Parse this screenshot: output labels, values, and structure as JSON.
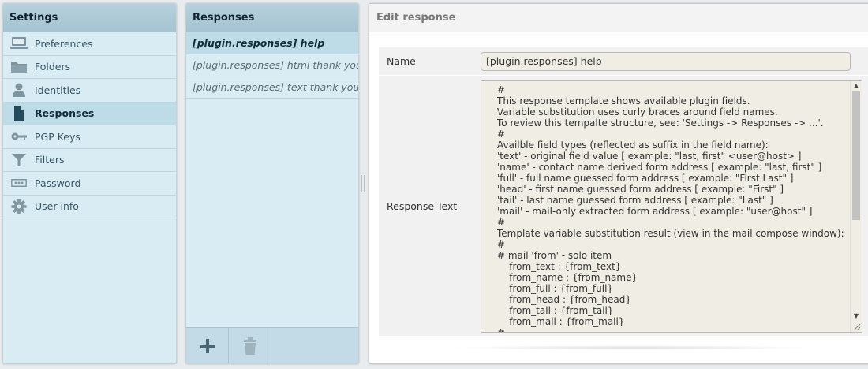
{
  "settings": {
    "title": "Settings",
    "items": [
      {
        "label": "Preferences",
        "icon": "monitor-icon",
        "name": "sidebar-item-preferences"
      },
      {
        "label": "Folders",
        "icon": "folder-icon",
        "name": "sidebar-item-folders"
      },
      {
        "label": "Identities",
        "icon": "person-icon",
        "name": "sidebar-item-identities"
      },
      {
        "label": "Responses",
        "icon": "document-icon",
        "name": "sidebar-item-responses",
        "selected": true
      },
      {
        "label": "PGP Keys",
        "icon": "key-icon",
        "name": "sidebar-item-pgp-keys"
      },
      {
        "label": "Filters",
        "icon": "filter-icon",
        "name": "sidebar-item-filters"
      },
      {
        "label": "Password",
        "icon": "password-icon",
        "name": "sidebar-item-password"
      },
      {
        "label": "User info",
        "icon": "gear-icon",
        "name": "sidebar-item-user-info"
      }
    ]
  },
  "responses": {
    "title": "Responses",
    "items": [
      {
        "label": "[plugin.responses] help",
        "selected": true
      },
      {
        "label": "[plugin.responses] html thank you"
      },
      {
        "label": "[plugin.responses] text thank you"
      }
    ],
    "footer": {
      "add_icon": "plus-icon",
      "delete_icon": "trash-icon"
    }
  },
  "edit": {
    "title": "Edit response",
    "name_label": "Name",
    "name_value": "[plugin.responses] help",
    "text_label": "Response Text",
    "text_value": "#\nThis response template shows available plugin fields.\nVariable substitution uses curly braces around field names.\nTo review this tempalte structure, see: 'Settings -> Responses -> ...'.\n#\nAvailble field types (reflected as suffix in the field name):\n'text' - original field value [ example: \"last, first\" <user@host> ]\n'name' - contact name derived form address [ example: \"last, first\" ]\n'full' - full name guessed form address [ example: \"First Last\" ]\n'head' - first name guessed form address [ example: \"First\" ]\n'tail' - last name guessed form address [ example: \"Last\" ]\n'mail' - mail-only extracted form address [ example: \"user@host\" ]\n#\nTemplate variable substitution result (view in the mail compose window):\n#\n# mail 'from' - solo item\n    from_text : {from_text}\n    from_name : {from_name}\n    from_full : {from_full}\n    from_head : {from_head}\n    from_tail : {from_tail}\n    from_mail : {from_mail}\n#"
  },
  "colors": {
    "panel_bg": "#d9ecf4",
    "header_bg": "#a5c3d1",
    "selected_bg": "#bedbe8",
    "field_bg": "#efede4"
  }
}
